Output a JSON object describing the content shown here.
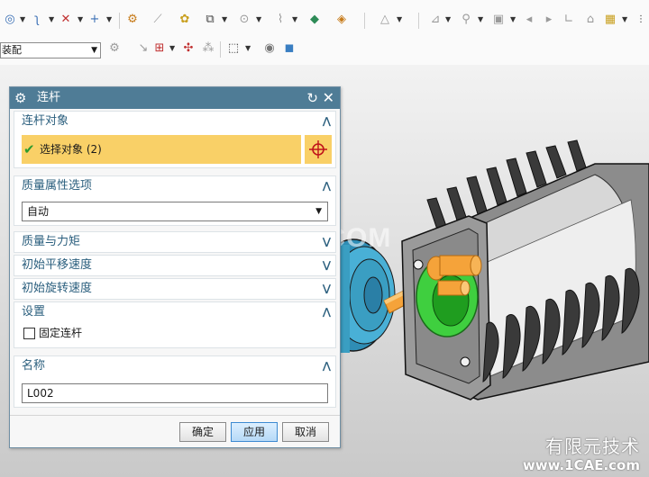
{
  "toolbar": {
    "assembly_dropdown_value": "装配"
  },
  "dialog": {
    "title": "连杆",
    "sections": {
      "link_objects": {
        "header": "连杆对象",
        "selection_label": "选择对象 (2)"
      },
      "mass_property_options": {
        "header": "质量属性选项",
        "selected_value": "自动"
      },
      "mass_and_inertia": {
        "header": "质量与力矩"
      },
      "initial_translational_velocity": {
        "header": "初始平移速度"
      },
      "initial_rotational_velocity": {
        "header": "初始旋转速度"
      },
      "settings": {
        "header": "设置",
        "fixed_link_label": "固定连杆",
        "fixed_link_checked": false
      },
      "name": {
        "header": "名称",
        "value": "L002"
      }
    },
    "buttons": {
      "ok": "确定",
      "apply": "应用",
      "cancel": "取消"
    }
  },
  "watermark": {
    "center_text": "1CAE.COM",
    "corner_line1": "有限元技术",
    "corner_line2": "www.1CAE.com"
  },
  "colors": {
    "dialog_titlebar": "#4f7c96",
    "section_header_text": "#2b5f7e",
    "selection_highlight": "#f9d067",
    "apply_button": "#b6d9f7",
    "model_link_orange": "#f5a33a",
    "model_green": "#3fcf3f",
    "model_blue_roller": "#3a9ec2"
  },
  "icons": {
    "dialog": "gear-icon",
    "reset": "reset-icon",
    "close": "close-icon",
    "check": "check-icon",
    "crosshair": "crosshair-icon"
  }
}
